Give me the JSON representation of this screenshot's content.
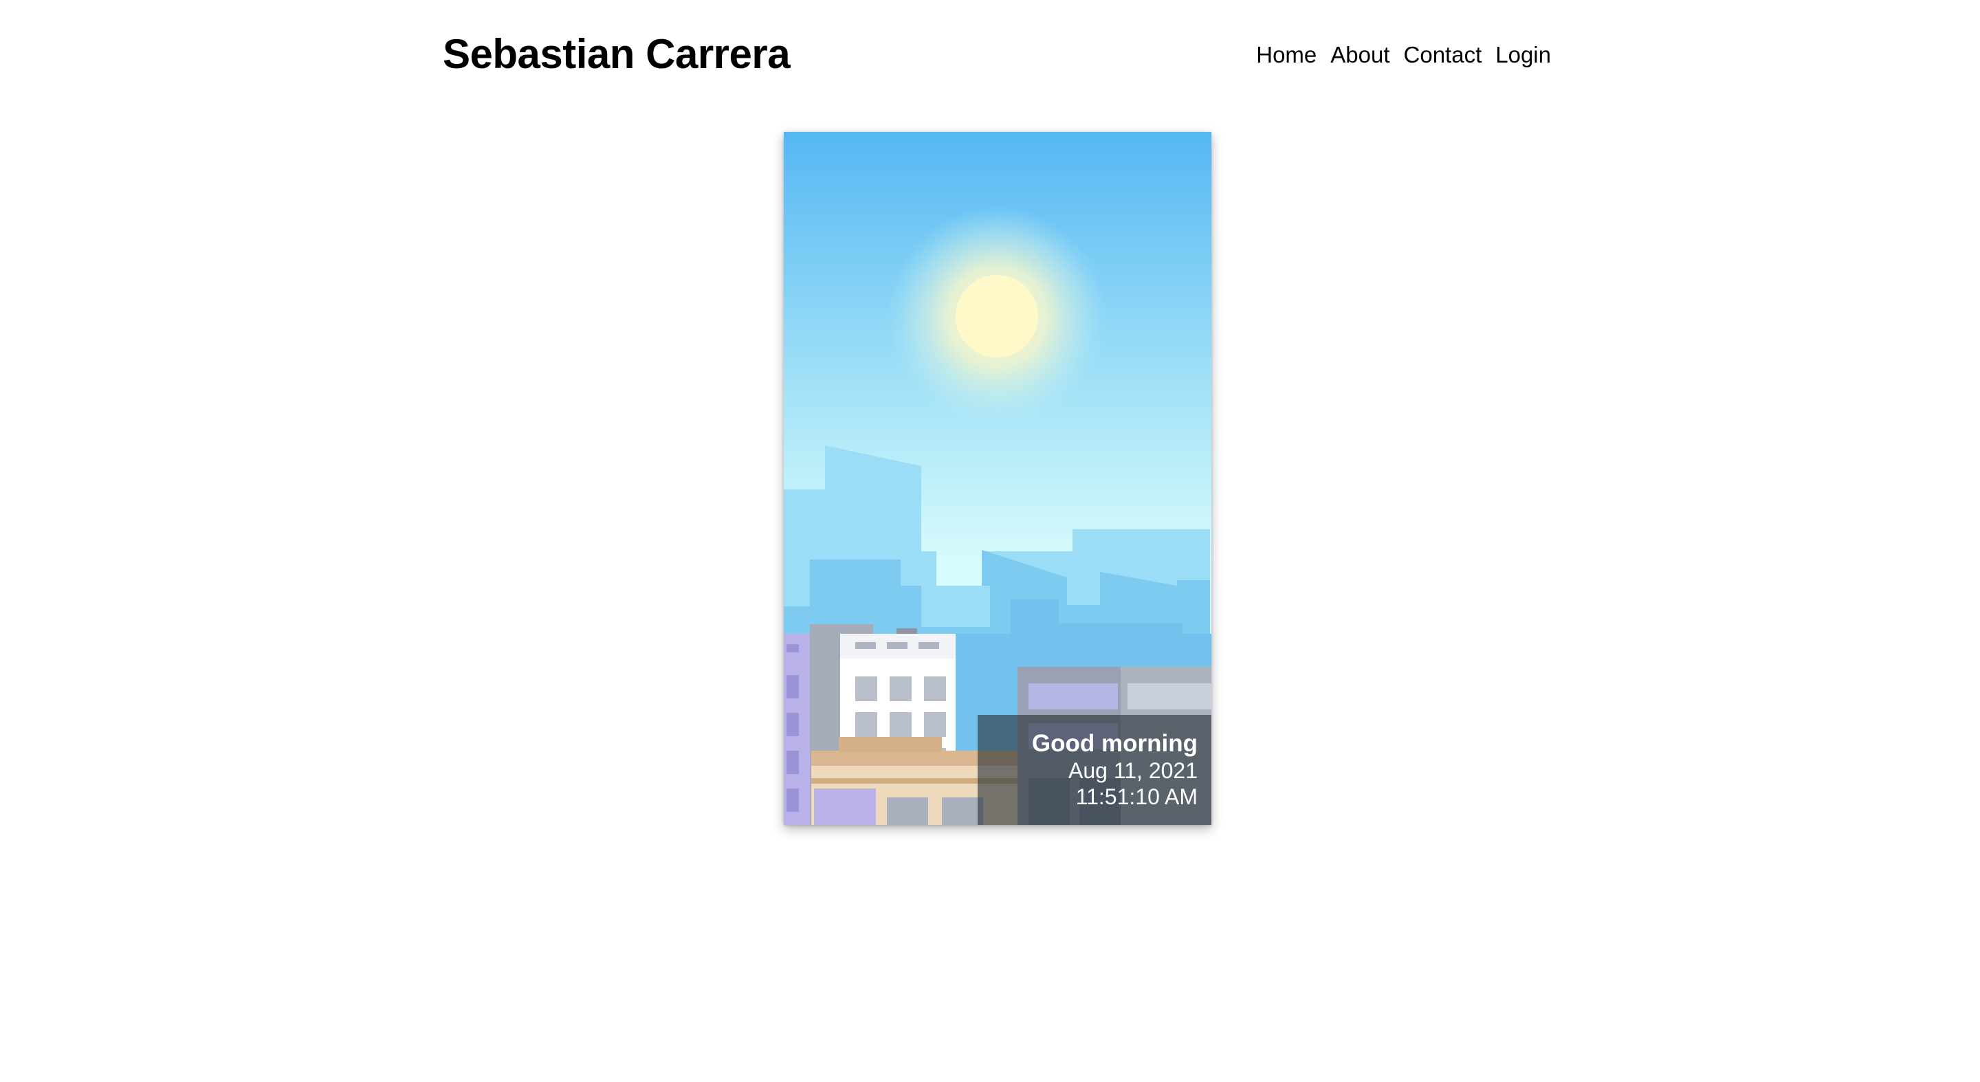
{
  "site": {
    "title": "Sebastian Carrera"
  },
  "nav": {
    "items": [
      {
        "label": "Home"
      },
      {
        "label": "About"
      },
      {
        "label": "Contact"
      },
      {
        "label": "Login"
      }
    ]
  },
  "card": {
    "illustration": "morning-city-skyline",
    "greeting": "Good morning",
    "date": "Aug 11, 2021",
    "time": "11:51:10 AM"
  },
  "colors": {
    "sky_top": "#55b7f3",
    "sky_bottom": "#d8fbfb",
    "sun": "#fff8c9",
    "overlay": "#283237"
  }
}
